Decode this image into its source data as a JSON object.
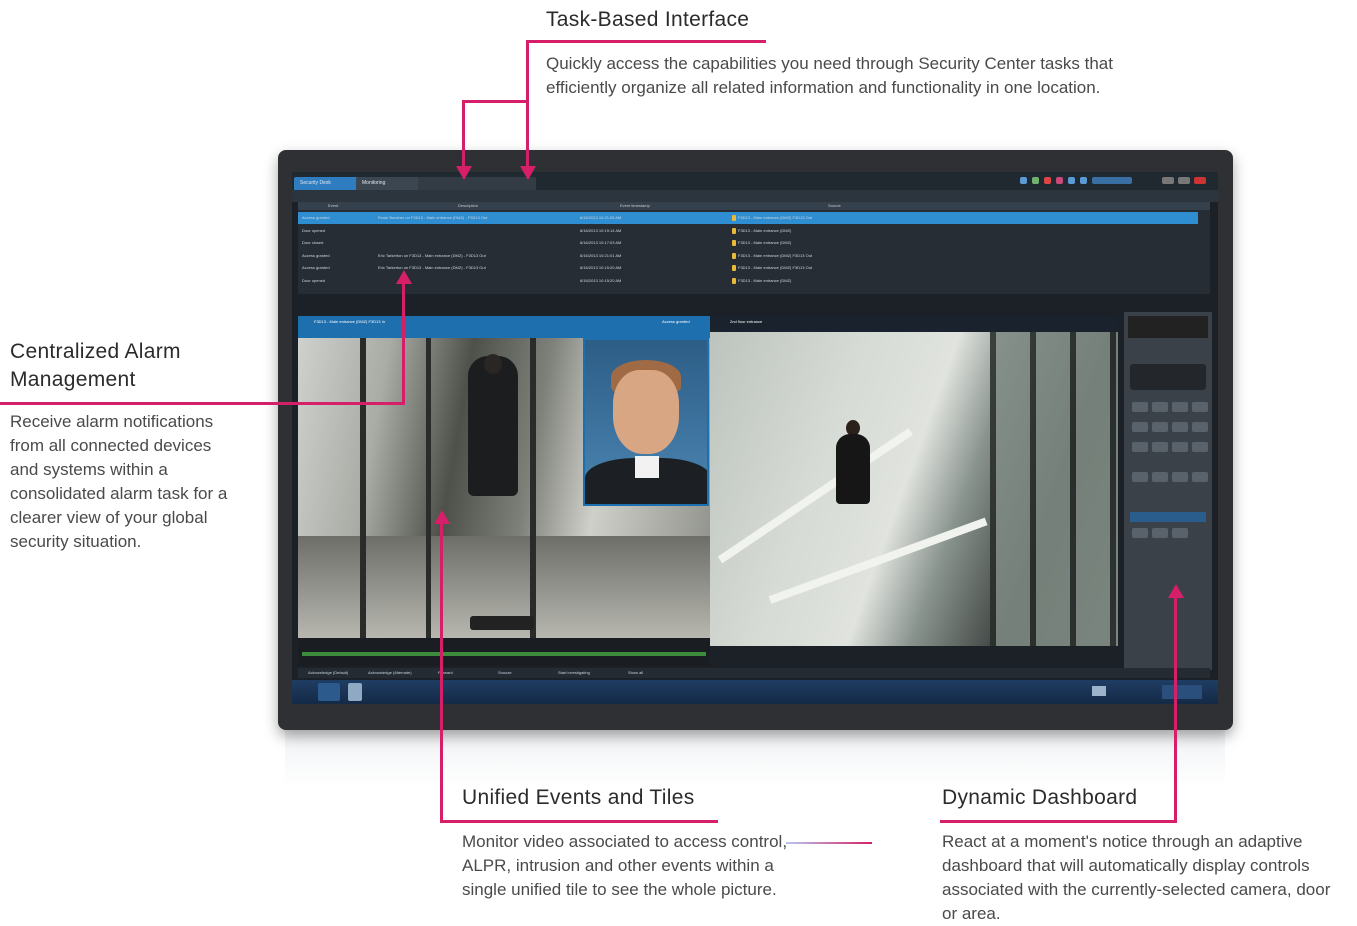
{
  "callouts": {
    "task_based": {
      "heading": "Task-Based Interface",
      "body": "Quickly access the capabilities you need through Security Center tasks that efficiently organize all related information and functionality in one location."
    },
    "centralized": {
      "heading_line1": "Centralized Alarm",
      "heading_line2": "Management",
      "body": "Receive alarm notifications from all connected devices and systems within a consolidated alarm task for a clearer view of your global security situation."
    },
    "unified": {
      "heading": "Unified Events and Tiles",
      "body": "Monitor video associated to access control, ALPR, intrusion and other events within a single unified tile to see the whole picture."
    },
    "dashboard": {
      "heading": "Dynamic Dashboard",
      "body": "React at a moment's notice through an adaptive dashboard that will automatically display controls associated with the currently-selected camera, door or area."
    }
  },
  "colors": {
    "accent": "#d61f69",
    "selected_row": "#2f8ed1",
    "tile_header": "#1e6fae"
  },
  "screen": {
    "tabs": [
      "Security Desk",
      "Monitoring"
    ],
    "alarm_columns": [
      "Event",
      "Description",
      "Event timestamp",
      "Source"
    ],
    "alarm_rows": [
      {
        "event": "Access granted",
        "description": "Rosie Buesher on F3D13 - Main entrance (DMZ) - F3D13 Out",
        "time": "8/16/2013 10:21:05 AM",
        "source": "F3D13 - Main entrance (DMZ) F3D13 Out",
        "selected": true
      },
      {
        "event": "Door opened",
        "description": "",
        "time": "8/16/2013 10:19:14 AM",
        "source": "F3D13 - Main entrance (DMZ)",
        "selected": false
      },
      {
        "event": "Door closed",
        "description": "",
        "time": "8/16/2013 10:17:03 AM",
        "source": "F3D13 - Main entrance (DMZ)",
        "selected": false
      },
      {
        "event": "Access granted",
        "description": "Eric Tarkerton on F3D13 - Main entrance (DMZ) - F3D13 Out",
        "time": "8/16/2013 10:21:01 AM",
        "source": "F3D13 - Main entrance (DMZ) F3D13 Out",
        "selected": false
      },
      {
        "event": "Access granted",
        "description": "Eric Tarkerton on F3D13 - Main entrance (DMZ) - F3D13 Out",
        "time": "8/16/2013 10:15:20 AM",
        "source": "F3D13 - Main entrance (DMZ) F3D13 Out",
        "selected": false
      },
      {
        "event": "Door opened",
        "description": "",
        "time": "8/16/2013 10:15:20 AM",
        "source": "F3D13 - Main entrance (DMZ)",
        "selected": false
      }
    ],
    "tile1_title": "F3D13 - Main entrance (DMZ) F3D13 In",
    "tile1_badge": "Access granted",
    "tile2_title": "2nd floor entrance",
    "status_items": [
      "Acknowledge (Default)",
      "Acknowledge (Alternate)",
      "Forward",
      "Snooze",
      "Start investigating",
      "Show all"
    ]
  }
}
